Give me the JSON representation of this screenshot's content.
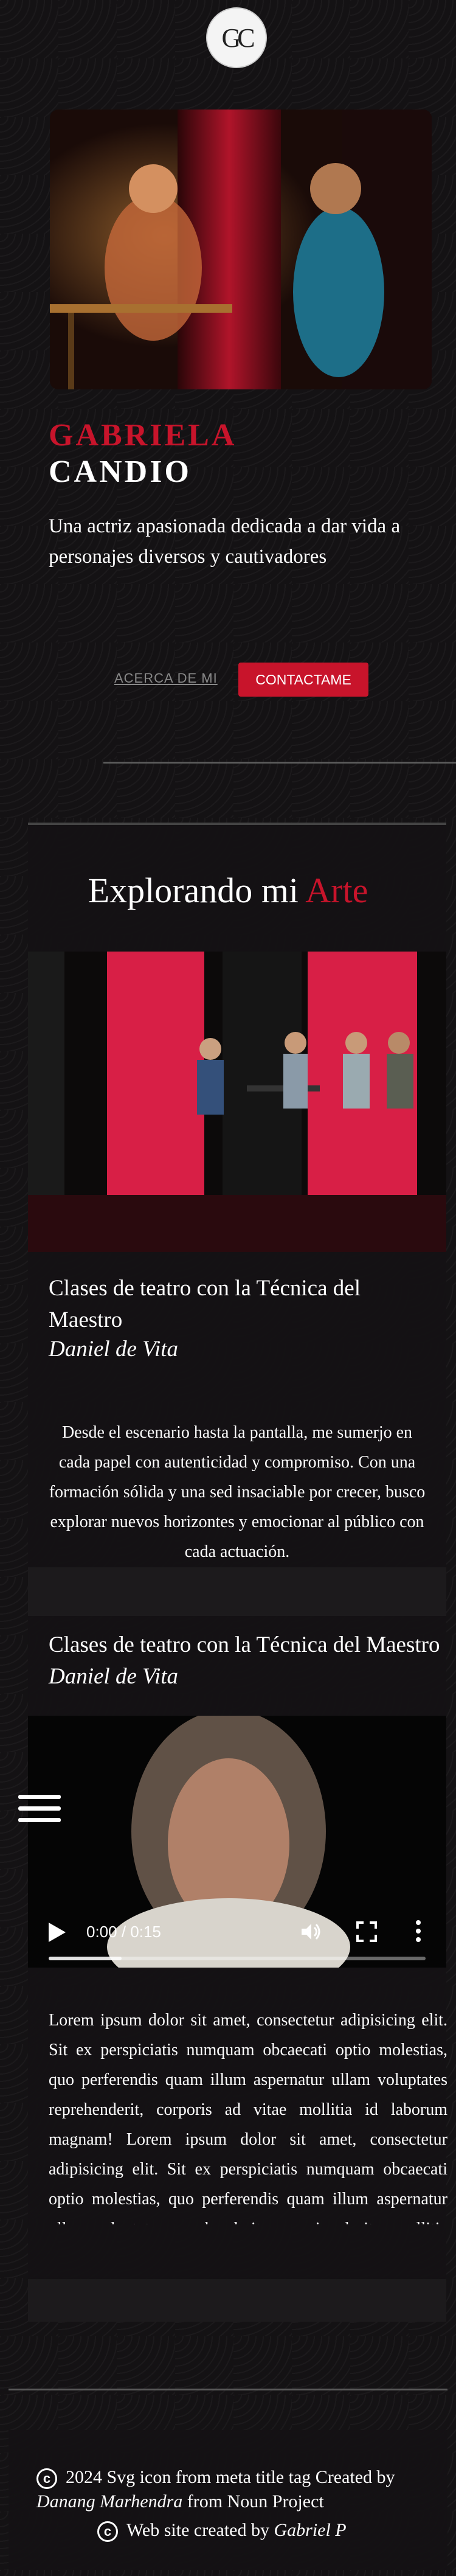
{
  "header": {
    "logo_text": "GC"
  },
  "hero": {
    "first_name": "GABRIELA",
    "last_name": "CANDIO",
    "tagline": "Una actriz apasionada dedicada a dar vida a personajes diversos y cautivadores",
    "about_link": "ACERCA DE MI",
    "contact_button": "CONTACTAME"
  },
  "section": {
    "title_prefix": "Explorando mi",
    "title_accent": "Arte"
  },
  "card1": {
    "title": "Clases de teatro con la Técnica del Maestro",
    "subtitle": "Daniel de Vita",
    "description": "Desde el escenario hasta la pantalla, me sumerjo en cada papel con autenticidad y compromiso. Con una formación sólida y una sed insaciable por crecer, busco explorar nuevos horizontes y emocionar al público con cada actuación."
  },
  "card2": {
    "title": "Clases de teatro con la Técnica del Maestro",
    "subtitle": "Daniel de Vita",
    "video": {
      "time": "0:00 / 0:15",
      "progress": 0.0,
      "buffered": 0.19
    },
    "text": "Lorem ipsum dolor sit amet, consectetur adipisicing elit. Sit ex perspiciatis numquam obcaecati optio molestias, quo perferendis quam illum aspernatur ullam voluptates reprehenderit, corporis ad vitae mollitia id laborum magnam! Lorem ipsum dolor sit amet, consectetur adipisicing elit. Sit ex perspiciatis numquam obcaecati optio molestias, quo perferendis quam illum aspernatur ullam voluptates reprehenderit, corporis ad vitae mollitia id laborum magnam!"
  },
  "footer": {
    "credit_prefix": "2024 Svg icon from meta title tag Created by",
    "credit_author": "Danang Marhendra",
    "credit_suffix": "from Noun Project",
    "site_prefix": "Web site created by",
    "site_author": "Gabriel P",
    "copyright_symbol": "c"
  },
  "colors": {
    "accent": "#c8142b",
    "background": "#141214"
  }
}
